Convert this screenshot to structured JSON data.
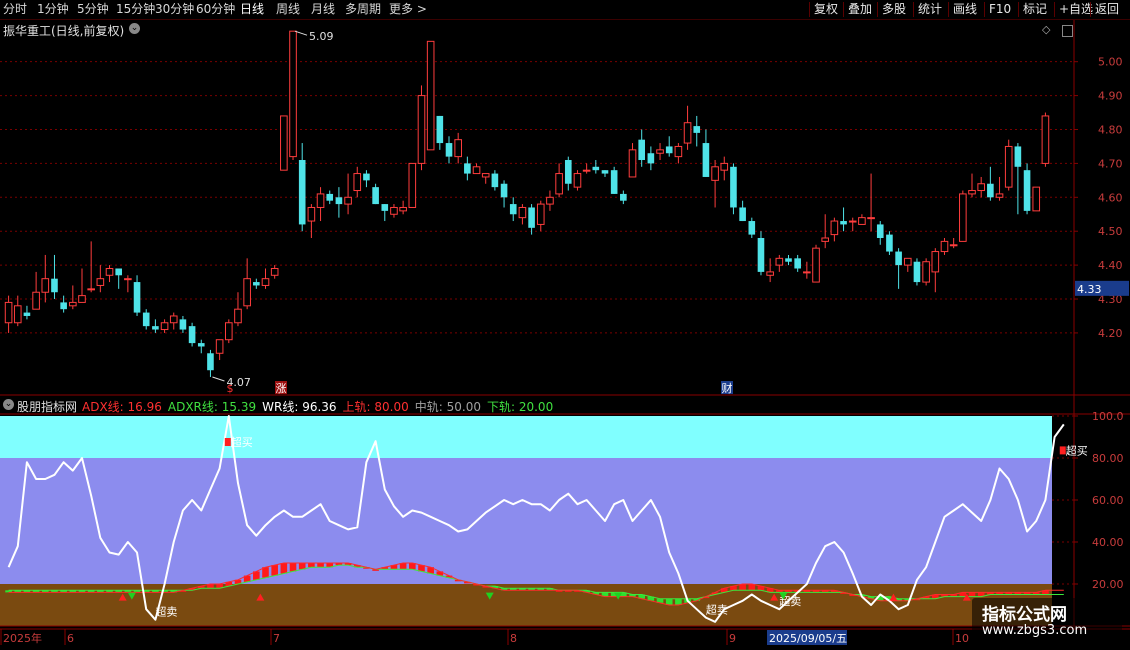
{
  "toolbar": {
    "periods": [
      "分时",
      "1分钟",
      "5分钟",
      "15分钟",
      "30分钟",
      "60分钟",
      "日线",
      "周线",
      "月线",
      "多周期",
      "更多 >"
    ],
    "active_period": "日线",
    "right_buttons": [
      "复权",
      "叠加",
      "多股",
      "统计",
      "画线",
      "F10",
      "标记",
      "+自选",
      "返回"
    ]
  },
  "main_chart": {
    "title": "振华重工(日线,前复权)",
    "price_ticks": [
      "5.00",
      "4.90",
      "4.80",
      "4.70",
      "4.60",
      "4.50",
      "4.40",
      "4.30",
      "4.20"
    ],
    "current_price_tag": "4.33",
    "high_marker": "5.09",
    "low_marker": "4.07",
    "event_markers": [
      "$",
      "涨",
      "财"
    ]
  },
  "indicator": {
    "name": "股朋指标网",
    "values": [
      {
        "label": "ADX线:",
        "value": "16.96",
        "color": "#ff3030"
      },
      {
        "label": "ADXR线:",
        "value": "15.39",
        "color": "#40e040"
      },
      {
        "label": "WR线:",
        "value": "96.36",
        "color": "#ffffff"
      },
      {
        "label": "上轨:",
        "value": "80.00",
        "color": "#ff3030"
      },
      {
        "label": "中轨:",
        "value": "50.00",
        "color": "#a0a0a0"
      },
      {
        "label": "下轨:",
        "value": "20.00",
        "color": "#40e040"
      }
    ],
    "axis_ticks": [
      "100.0",
      "80.00",
      "60.00",
      "40.00",
      "20.00"
    ],
    "overbought_label": "超买",
    "oversold_label": "超卖"
  },
  "date_axis": {
    "labels": [
      "2025年",
      "6",
      "7",
      "8",
      "9",
      "10"
    ],
    "highlight_date": "2025/09/05/五"
  },
  "watermark": {
    "title": "指标公式网",
    "url": "www.zbgs3.com"
  },
  "colors": {
    "up": "#ff3d3d",
    "down": "#4fe3e8",
    "grid": "#7a0000",
    "band_top": "#80ffff",
    "band_mid": "#8c8cee",
    "band_bottom": "#7a4a10"
  },
  "chart_data": [
    {
      "type": "candlestick",
      "title": "振华重工(日线,前复权)",
      "ylim": [
        4.07,
        5.12
      ],
      "y_ticks": [
        4.2,
        4.3,
        4.4,
        4.5,
        4.6,
        4.7,
        4.8,
        4.9,
        5.0
      ],
      "high": 5.09,
      "low": 4.07,
      "last": 4.33,
      "candles": [
        [
          4.23,
          4.29,
          4.2,
          4.31
        ],
        [
          4.23,
          4.28,
          4.22,
          4.31
        ],
        [
          4.26,
          4.25,
          4.24,
          4.28
        ],
        [
          4.27,
          4.32,
          4.27,
          4.38
        ],
        [
          4.32,
          4.36,
          4.29,
          4.43
        ],
        [
          4.36,
          4.32,
          4.3,
          4.43
        ],
        [
          4.29,
          4.27,
          4.26,
          4.31
        ],
        [
          4.28,
          4.29,
          4.27,
          4.34
        ],
        [
          4.29,
          4.31,
          4.29,
          4.39
        ],
        [
          4.33,
          4.33,
          4.32,
          4.47
        ],
        [
          4.34,
          4.36,
          4.32,
          4.4
        ],
        [
          4.37,
          4.39,
          4.35,
          4.4
        ],
        [
          4.39,
          4.37,
          4.33,
          4.39
        ],
        [
          4.36,
          4.36,
          4.32,
          4.37
        ],
        [
          4.35,
          4.26,
          4.25,
          4.37
        ],
        [
          4.26,
          4.22,
          4.21,
          4.27
        ],
        [
          4.22,
          4.21,
          4.2,
          4.24
        ],
        [
          4.21,
          4.23,
          4.2,
          4.24
        ],
        [
          4.23,
          4.25,
          4.21,
          4.26
        ],
        [
          4.24,
          4.21,
          4.2,
          4.25
        ],
        [
          4.22,
          4.17,
          4.16,
          4.23
        ],
        [
          4.17,
          4.16,
          4.14,
          4.18
        ],
        [
          4.14,
          4.09,
          4.07,
          4.15
        ],
        [
          4.14,
          4.18,
          4.12,
          4.18
        ],
        [
          4.18,
          4.23,
          4.17,
          4.24
        ],
        [
          4.23,
          4.27,
          4.22,
          4.32
        ],
        [
          4.28,
          4.36,
          4.27,
          4.42
        ],
        [
          4.35,
          4.34,
          4.33,
          4.36
        ],
        [
          4.34,
          4.36,
          4.33,
          4.39
        ],
        [
          4.37,
          4.39,
          4.36,
          4.4
        ],
        [
          4.68,
          4.84,
          4.68,
          4.84
        ],
        [
          4.72,
          5.09,
          4.71,
          5.09
        ],
        [
          4.71,
          4.52,
          4.5,
          4.76
        ],
        [
          4.53,
          4.57,
          4.48,
          4.58
        ],
        [
          4.57,
          4.61,
          4.53,
          4.63
        ],
        [
          4.61,
          4.59,
          4.58,
          4.62
        ],
        [
          4.6,
          4.58,
          4.54,
          4.63
        ],
        [
          4.58,
          4.6,
          4.55,
          4.67
        ],
        [
          4.62,
          4.67,
          4.6,
          4.69
        ],
        [
          4.67,
          4.65,
          4.63,
          4.68
        ],
        [
          4.63,
          4.58,
          4.58,
          4.64
        ],
        [
          4.58,
          4.56,
          4.53,
          4.58
        ],
        [
          4.55,
          4.57,
          4.54,
          4.58
        ],
        [
          4.56,
          4.57,
          4.55,
          4.59
        ],
        [
          4.57,
          4.7,
          4.57,
          4.7
        ],
        [
          4.7,
          4.9,
          4.68,
          4.93
        ],
        [
          4.74,
          5.06,
          4.74,
          5.06
        ],
        [
          4.84,
          4.76,
          4.74,
          4.84
        ],
        [
          4.76,
          4.72,
          4.7,
          4.78
        ],
        [
          4.72,
          4.77,
          4.7,
          4.79
        ],
        [
          4.7,
          4.67,
          4.65,
          4.72
        ],
        [
          4.67,
          4.69,
          4.67,
          4.7
        ],
        [
          4.66,
          4.67,
          4.64,
          4.67
        ],
        [
          4.67,
          4.63,
          4.62,
          4.68
        ],
        [
          4.64,
          4.6,
          4.57,
          4.65
        ],
        [
          4.58,
          4.55,
          4.53,
          4.6
        ],
        [
          4.54,
          4.57,
          4.52,
          4.58
        ],
        [
          4.57,
          4.51,
          4.49,
          4.58
        ],
        [
          4.52,
          4.58,
          4.5,
          4.59
        ],
        [
          4.58,
          4.6,
          4.56,
          4.62
        ],
        [
          4.61,
          4.67,
          4.6,
          4.7
        ],
        [
          4.71,
          4.64,
          4.62,
          4.72
        ],
        [
          4.63,
          4.67,
          4.62,
          4.68
        ],
        [
          4.68,
          4.68,
          4.67,
          4.7
        ],
        [
          4.69,
          4.68,
          4.67,
          4.71
        ],
        [
          4.68,
          4.67,
          4.66,
          4.68
        ],
        [
          4.68,
          4.61,
          4.61,
          4.69
        ],
        [
          4.61,
          4.59,
          4.58,
          4.62
        ],
        [
          4.66,
          4.74,
          4.66,
          4.76
        ],
        [
          4.77,
          4.71,
          4.69,
          4.8
        ],
        [
          4.73,
          4.7,
          4.68,
          4.75
        ],
        [
          4.73,
          4.74,
          4.71,
          4.76
        ],
        [
          4.75,
          4.73,
          4.72,
          4.78
        ],
        [
          4.72,
          4.75,
          4.7,
          4.76
        ],
        [
          4.76,
          4.82,
          4.74,
          4.87
        ],
        [
          4.81,
          4.79,
          4.75,
          4.84
        ],
        [
          4.76,
          4.66,
          4.66,
          4.8
        ],
        [
          4.65,
          4.69,
          4.57,
          4.71
        ],
        [
          4.68,
          4.7,
          4.65,
          4.72
        ],
        [
          4.69,
          4.57,
          4.55,
          4.7
        ],
        [
          4.57,
          4.53,
          4.53,
          4.59
        ],
        [
          4.53,
          4.49,
          4.48,
          4.54
        ],
        [
          4.48,
          4.38,
          4.37,
          4.5
        ],
        [
          4.37,
          4.38,
          4.35,
          4.42
        ],
        [
          4.4,
          4.42,
          4.38,
          4.43
        ],
        [
          4.42,
          4.41,
          4.4,
          4.43
        ],
        [
          4.42,
          4.39,
          4.38,
          4.43
        ],
        [
          4.38,
          4.38,
          4.36,
          4.41
        ],
        [
          4.35,
          4.45,
          4.35,
          4.46
        ],
        [
          4.47,
          4.48,
          4.45,
          4.55
        ],
        [
          4.49,
          4.53,
          4.47,
          4.54
        ],
        [
          4.53,
          4.52,
          4.5,
          4.57
        ],
        [
          4.53,
          4.53,
          4.5,
          4.54
        ],
        [
          4.52,
          4.54,
          4.52,
          4.55
        ],
        [
          4.54,
          4.54,
          4.5,
          4.67
        ],
        [
          4.52,
          4.48,
          4.46,
          4.53
        ],
        [
          4.49,
          4.44,
          4.43,
          4.5
        ],
        [
          4.44,
          4.4,
          4.33,
          4.45
        ],
        [
          4.4,
          4.42,
          4.38,
          4.42
        ],
        [
          4.41,
          4.35,
          4.34,
          4.42
        ],
        [
          4.35,
          4.41,
          4.34,
          4.42
        ],
        [
          4.38,
          4.44,
          4.32,
          4.45
        ],
        [
          4.44,
          4.47,
          4.43,
          4.48
        ],
        [
          4.46,
          4.46,
          4.45,
          4.48
        ],
        [
          4.47,
          4.61,
          4.47,
          4.62
        ],
        [
          4.61,
          4.62,
          4.6,
          4.67
        ],
        [
          4.62,
          4.64,
          4.6,
          4.66
        ],
        [
          4.64,
          4.6,
          4.59,
          4.69
        ],
        [
          4.6,
          4.61,
          4.59,
          4.66
        ],
        [
          4.63,
          4.75,
          4.62,
          4.77
        ],
        [
          4.75,
          4.69,
          4.55,
          4.76
        ],
        [
          4.68,
          4.56,
          4.55,
          4.7
        ],
        [
          4.56,
          4.63,
          4.56,
          4.63
        ],
        [
          4.7,
          4.84,
          4.69,
          4.85
        ]
      ]
    },
    {
      "type": "line",
      "title": "股朋指标网",
      "ylim": [
        0,
        100
      ],
      "y_ticks": [
        20,
        40,
        60,
        80,
        100
      ],
      "bands": [
        20,
        50,
        80
      ],
      "series": [
        {
          "name": "WR线",
          "values": [
            28,
            38,
            78,
            70,
            70,
            72,
            78,
            74,
            80,
            62,
            42,
            35,
            34,
            40,
            35,
            8,
            3,
            20,
            40,
            55,
            60,
            55,
            65,
            75,
            100,
            68,
            48,
            43,
            48,
            52,
            55,
            52,
            52,
            55,
            58,
            50,
            48,
            46,
            47,
            78,
            88,
            65,
            57,
            52,
            55,
            54,
            52,
            50,
            48,
            45,
            46,
            50,
            54,
            57,
            60,
            58,
            60,
            58,
            58,
            55,
            60,
            63,
            58,
            60,
            55,
            50,
            58,
            60,
            50,
            55,
            60,
            52,
            35,
            25,
            12,
            8,
            4,
            2,
            8,
            10,
            12,
            15,
            12,
            10,
            8,
            12,
            16,
            20,
            30,
            38,
            40,
            35,
            25,
            14,
            10,
            15,
            12,
            8,
            10,
            22,
            28,
            40,
            52,
            55,
            58,
            54,
            50,
            60,
            75,
            70,
            60,
            45,
            50,
            60,
            90,
            96
          ]
        },
        {
          "name": "ADX线",
          "values": [
            16,
            16,
            16,
            16,
            16,
            16,
            16,
            16,
            16,
            16,
            16,
            16,
            16,
            16,
            16,
            16,
            16,
            16,
            16,
            17,
            18,
            19,
            20,
            20,
            21,
            22,
            24,
            26,
            28,
            29,
            30,
            30,
            30,
            30,
            30,
            30,
            30,
            30,
            29,
            28,
            27,
            28,
            29,
            30,
            30,
            29,
            28,
            26,
            24,
            22,
            21,
            20,
            19,
            18,
            17,
            17,
            17,
            17,
            17,
            17,
            17,
            17,
            17,
            16,
            15,
            14,
            14,
            14,
            14,
            13,
            12,
            11,
            10,
            10,
            11,
            12,
            14,
            16,
            18,
            19,
            20,
            20,
            19,
            18,
            17,
            17,
            17,
            17,
            17,
            17,
            17,
            16,
            15,
            14,
            13,
            12,
            12,
            12,
            12,
            13,
            14,
            15,
            15,
            15,
            16,
            16,
            16,
            16,
            16,
            16,
            16,
            16,
            16,
            17,
            17,
            17
          ]
        },
        {
          "name": "ADXR线",
          "values": [
            17,
            17,
            17,
            17,
            17,
            17,
            17,
            17,
            17,
            17,
            17,
            17,
            17,
            17,
            17,
            17,
            17,
            17,
            17,
            17,
            17,
            18,
            18,
            18,
            19,
            20,
            21,
            22,
            23,
            24,
            25,
            26,
            27,
            28,
            28,
            28,
            29,
            29,
            28,
            28,
            27,
            27,
            27,
            27,
            27,
            26,
            25,
            24,
            23,
            22,
            21,
            20,
            19,
            19,
            18,
            18,
            18,
            18,
            18,
            18,
            17,
            17,
            17,
            17,
            16,
            16,
            16,
            16,
            15,
            15,
            14,
            13,
            13,
            13,
            13,
            13,
            14,
            15,
            16,
            17,
            17,
            17,
            17,
            16,
            16,
            16,
            16,
            16,
            16,
            16,
            16,
            16,
            15,
            15,
            14,
            14,
            14,
            13,
            13,
            13,
            13,
            13,
            14,
            14,
            14,
            14,
            14,
            15,
            15,
            15,
            15,
            15,
            15,
            15,
            15,
            15
          ]
        }
      ]
    }
  ]
}
